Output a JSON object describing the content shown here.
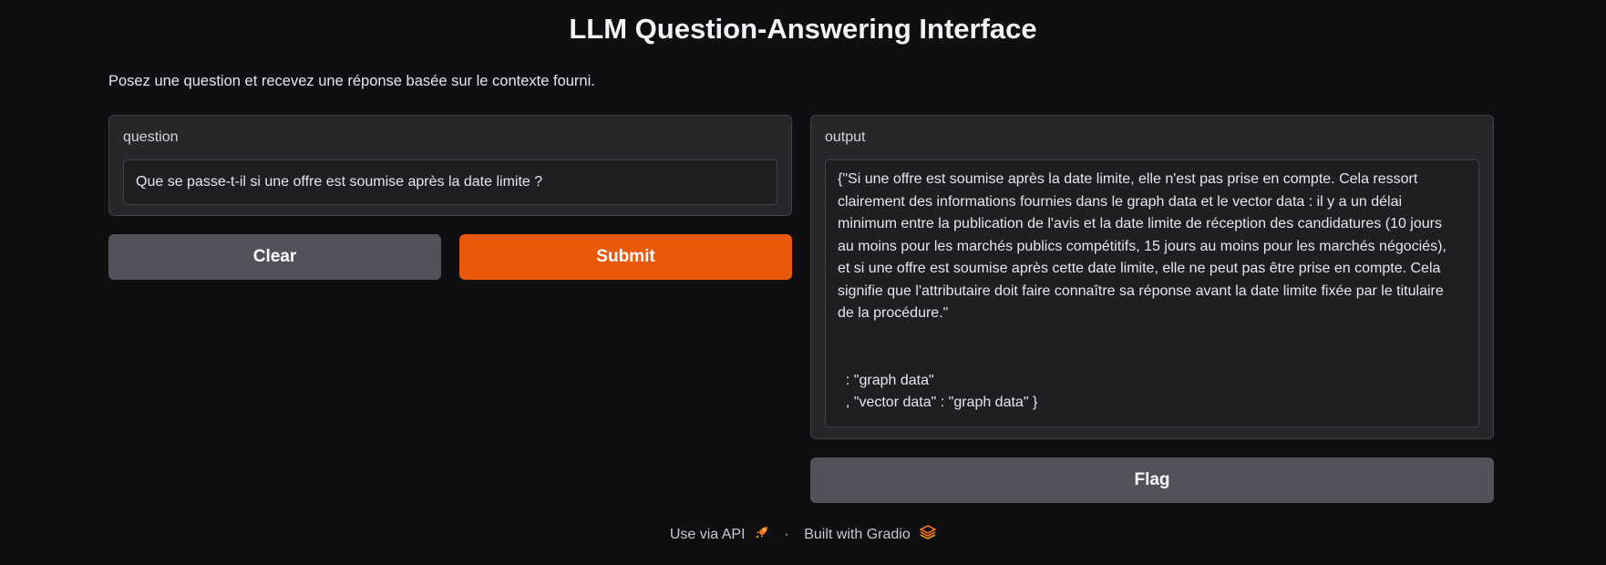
{
  "header": {
    "title": "LLM Question-Answering Interface",
    "description": "Posez une question et recevez une réponse basée sur le contexte fourni."
  },
  "input_panel": {
    "label": "question",
    "value": "Que se passe-t-il si une offre est soumise après la date limite ?"
  },
  "buttons": {
    "clear": "Clear",
    "submit": "Submit",
    "flag": "Flag"
  },
  "output_panel": {
    "label": "output",
    "value": "{\"Si une offre est soumise après la date limite, elle n'est pas prise en compte. Cela ressort\nclairement des informations fournies dans le graph data et le vector data : il y a un délai\nminimum entre la publication de l'avis et la date limite de réception des candidatures (10 jours\nau moins pour les marchés publics compétitifs, 15 jours au moins pour les marchés négociés),\net si une offre est soumise après cette date limite, elle ne peut pas être prise en compte. Cela\nsignifie que l'attributaire doit faire connaître sa réponse avant la date limite fixée par le titulaire\nde la procédure.\"\n\n\n  : \"graph data\"\n  , \"vector data\" : \"graph data\" }"
  },
  "footer": {
    "api_link": "Use via API",
    "separator": "·",
    "built_with": "Built with Gradio"
  },
  "colors": {
    "accent": "#ea580c",
    "secondary_button": "#52525b",
    "panel": "#27272a",
    "background": "#0f0f12"
  },
  "icons": {
    "api": "rocket-icon",
    "gradio": "gradio-logo-icon"
  }
}
